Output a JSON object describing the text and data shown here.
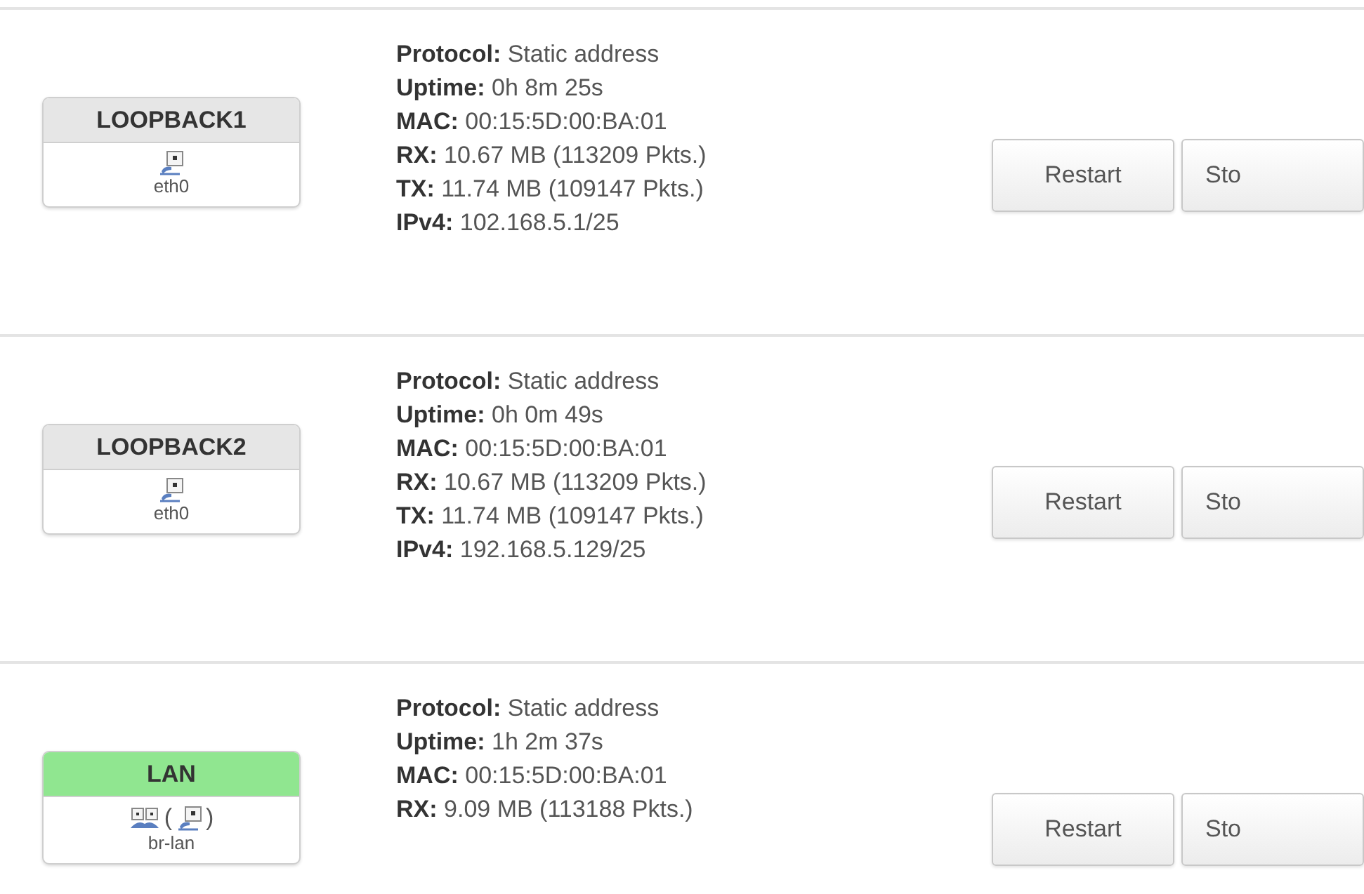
{
  "interfaces": [
    {
      "name": "LOOPBACK1",
      "color": "#e6e6e6",
      "device_line": [
        {
          "kind": "ethernet"
        }
      ],
      "device": "eth0",
      "info": [
        {
          "label": "Protocol:",
          "value": "Static address"
        },
        {
          "label": "Uptime:",
          "value": "0h 8m 25s"
        },
        {
          "label": "MAC:",
          "value": "00:15:5D:00:BA:01"
        },
        {
          "label": "RX:",
          "value": "10.67 MB (113209 Pkts.)"
        },
        {
          "label": "TX:",
          "value": "11.74 MB (109147 Pkts.)"
        },
        {
          "label": "IPv4:",
          "value": "102.168.5.1/25"
        }
      ],
      "buttons": [
        "Restart",
        "Sto"
      ]
    },
    {
      "name": "LOOPBACK2",
      "color": "#e6e6e6",
      "device_line": [
        {
          "kind": "ethernet"
        }
      ],
      "device": "eth0",
      "info": [
        {
          "label": "Protocol:",
          "value": "Static address"
        },
        {
          "label": "Uptime:",
          "value": "0h 0m 49s"
        },
        {
          "label": "MAC:",
          "value": "00:15:5D:00:BA:01"
        },
        {
          "label": "RX:",
          "value": "10.67 MB (113209 Pkts.)"
        },
        {
          "label": "TX:",
          "value": "11.74 MB (109147 Pkts.)"
        },
        {
          "label": "IPv4:",
          "value": "192.168.5.129/25"
        }
      ],
      "buttons": [
        "Restart",
        "Sto"
      ]
    },
    {
      "name": "LAN",
      "color": "#90e690",
      "device_line": [
        {
          "kind": "bridge"
        },
        {
          "kind": "text",
          "text": "("
        },
        {
          "kind": "ethernet"
        },
        {
          "kind": "text",
          "text": ")"
        }
      ],
      "device": "br-lan",
      "info": [
        {
          "label": "Protocol:",
          "value": "Static address"
        },
        {
          "label": "Uptime:",
          "value": "1h 2m 37s"
        },
        {
          "label": "MAC:",
          "value": "00:15:5D:00:BA:01"
        },
        {
          "label": "RX:",
          "value": "9.09 MB (113188 Pkts.)"
        }
      ],
      "buttons": [
        "Restart",
        "Sto"
      ]
    }
  ]
}
